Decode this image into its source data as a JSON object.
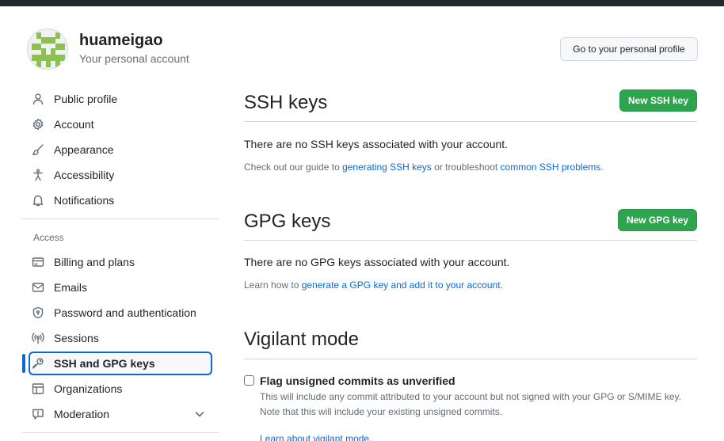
{
  "header": {
    "username": "huameigao",
    "subtitle": "Your personal account",
    "profile_button": "Go to your personal profile"
  },
  "sidebar": {
    "items": [
      {
        "label": "Public profile",
        "icon": "person-icon"
      },
      {
        "label": "Account",
        "icon": "gear-icon"
      },
      {
        "label": "Appearance",
        "icon": "paintbrush-icon"
      },
      {
        "label": "Accessibility",
        "icon": "accessibility-icon"
      },
      {
        "label": "Notifications",
        "icon": "bell-icon"
      }
    ],
    "access_heading": "Access",
    "access_items": [
      {
        "label": "Billing and plans",
        "icon": "credit-card-icon"
      },
      {
        "label": "Emails",
        "icon": "mail-icon"
      },
      {
        "label": "Password and authentication",
        "icon": "shield-lock-icon"
      },
      {
        "label": "Sessions",
        "icon": "broadcast-icon"
      },
      {
        "label": "SSH and GPG keys",
        "icon": "key-icon",
        "active": true
      },
      {
        "label": "Organizations",
        "icon": "table-icon"
      },
      {
        "label": "Moderation",
        "icon": "report-icon"
      }
    ]
  },
  "ssh": {
    "title": "SSH keys",
    "button": "New SSH key",
    "empty": "There are no SSH keys associated with your account.",
    "note_prefix": "Check out our guide to ",
    "link1": "generating SSH keys",
    "note_middle": " or troubleshoot ",
    "link2": "common SSH problems",
    "note_suffix": "."
  },
  "gpg": {
    "title": "GPG keys",
    "button": "New GPG key",
    "empty": "There are no GPG keys associated with your account.",
    "note_prefix": "Learn how to ",
    "link": "generate a GPG key and add it to your account",
    "note_suffix": "."
  },
  "vigilant": {
    "title": "Vigilant mode",
    "checkbox_label": "Flag unsigned commits as unverified",
    "checked": false,
    "note1": "This will include any commit attributed to your account but not signed with your GPG or S/MIME key.",
    "note2": "Note that this will include your existing unsigned commits.",
    "link": "Learn about vigilant mode."
  },
  "colors": {
    "accent": "#0969da",
    "primary_button": "#2da44e",
    "topbar": "#24292f"
  }
}
